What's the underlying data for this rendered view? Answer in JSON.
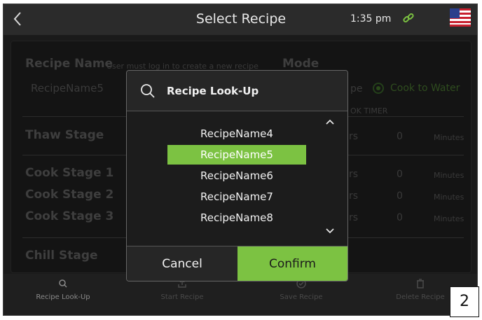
{
  "topbar": {
    "back_icon": "chevron-left-icon",
    "title": "Select Recipe",
    "time": "1:35 pm",
    "link_icon": "link-icon",
    "flag_icon": "us-flag-icon"
  },
  "form": {
    "recipe_name_label": "Recipe Name",
    "recipe_name_hint": "User must log in to create a new recipe",
    "recipe_name_value": "RecipeName5",
    "mode_label": "Mode",
    "mode_partial": "pe",
    "cook_to_water": "Cook to Water",
    "cook_timer_partial": "OK TIMER",
    "thaw_stage": "Thaw Stage",
    "cook_stage_1": "Cook Stage 1",
    "cook_stage_2": "Cook Stage 2",
    "cook_stage_3": "Cook Stage 3",
    "chill_stage": "Chill Stage",
    "hours_partial": "rs",
    "rows": [
      {
        "value": "0",
        "unit": "Minutes"
      },
      {
        "value": "0",
        "unit": "Minutes"
      },
      {
        "value": "0",
        "unit": "Minutes"
      },
      {
        "value": "0",
        "unit": "Minutes"
      }
    ]
  },
  "bottombar": {
    "recipe_lookup": "Recipe Look-Up",
    "start_recipe": "Start Recipe",
    "save_recipe": "Save Recipe",
    "delete_recipe": "Delete Recipe"
  },
  "modal": {
    "title": "Recipe Look-Up",
    "items": [
      "RecipeName4",
      "RecipeName5",
      "RecipeName6",
      "RecipeName7",
      "RecipeName8"
    ],
    "selected": "RecipeName5",
    "cancel_label": "Cancel",
    "confirm_label": "Confirm",
    "accent_color": "#7cc242"
  },
  "page_number": "2"
}
